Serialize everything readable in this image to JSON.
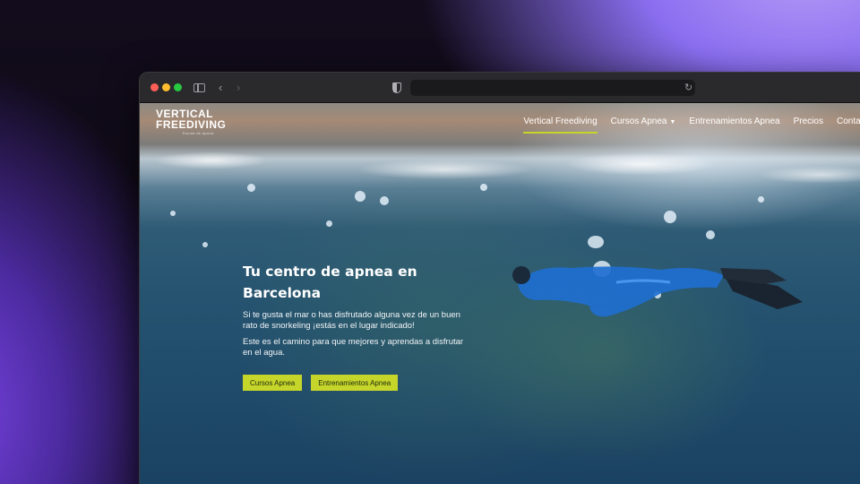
{
  "browser": {
    "traffic_lights": [
      "close",
      "minimize",
      "zoom"
    ],
    "url": ""
  },
  "site": {
    "logo": {
      "line1": "VERTICAL",
      "line2": "FREEDIVING",
      "tagline": "Escola de Apnea"
    },
    "nav": [
      {
        "label": "Vertical Freediving",
        "active": true
      },
      {
        "label": "Cursos Apnea",
        "dropdown": true
      },
      {
        "label": "Entrenamientos Apnea"
      },
      {
        "label": "Precios"
      },
      {
        "label": "Contacto"
      }
    ],
    "hero": {
      "title_line1": "Tu centro de apnea en",
      "title_line2": "Barcelona",
      "paragraph1": "Si te gusta el mar o has disfrutado alguna vez de un buen rato de snorkeling ¡estás en el lugar indicado!",
      "paragraph2": "Este es el camino para que mejores y aprendas a disfrutar en el agua.",
      "button1": "Cursos Apnea",
      "button2": "Entrenamientos Apnea"
    }
  },
  "colors": {
    "accent": "#c6d52a",
    "water": "#1f4a6a"
  }
}
